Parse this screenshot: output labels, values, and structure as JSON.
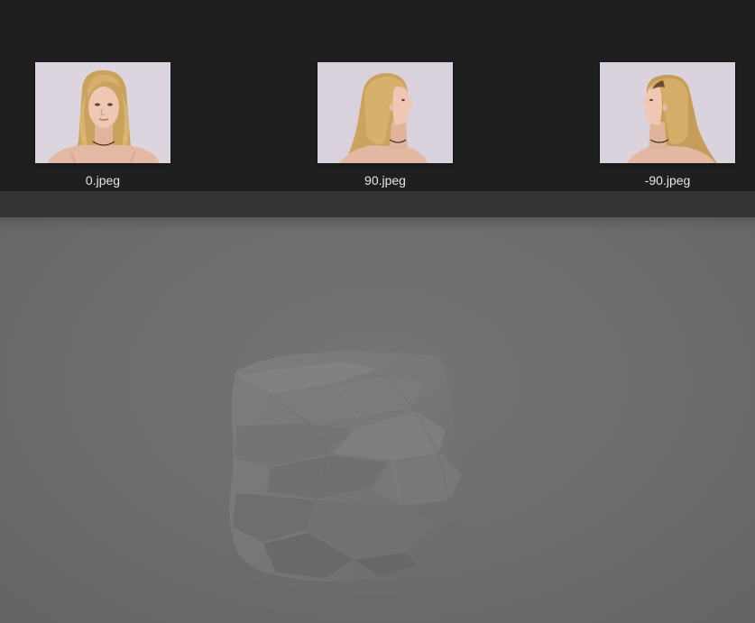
{
  "file_strip": {
    "items": [
      {
        "label": "0.jpeg",
        "icon": "photo-front-view"
      },
      {
        "label": "90.jpeg",
        "icon": "photo-right-profile"
      },
      {
        "label": "-90.jpeg",
        "icon": "photo-left-profile"
      }
    ]
  },
  "viewport": {
    "object": "reconstructed-head-mesh",
    "background_color": "#6f6f6f",
    "mesh_color": "#7a7a7a"
  }
}
